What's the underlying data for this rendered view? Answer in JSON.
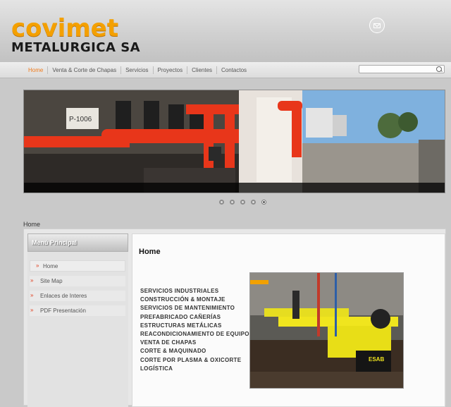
{
  "logo": {
    "line1": "covimet",
    "line2": "METALURGICA SA"
  },
  "header": {
    "mail_icon": "mail-icon"
  },
  "nav": {
    "items": [
      {
        "label": "Home",
        "active": true
      },
      {
        "label": "Venta & Corte de Chapas"
      },
      {
        "label": "Servicios"
      },
      {
        "label": "Proyectos"
      },
      {
        "label": "Clientes"
      },
      {
        "label": "Contactos"
      }
    ]
  },
  "search": {
    "value": "",
    "icon": "search-icon"
  },
  "slider": {
    "dots": 5,
    "active_dot": 5
  },
  "breadcrumb": "Home",
  "sidebar": {
    "title": "Menú Principal",
    "items": [
      {
        "label": "Home",
        "icon": "double-arrow-icon"
      },
      {
        "label": "Site Map",
        "icon": "double-arrow-icon"
      },
      {
        "label": "Enlaces de Interes",
        "icon": "double-arrow-icon"
      },
      {
        "label": "PDF Presentación",
        "icon": "double-arrow-icon"
      }
    ]
  },
  "main": {
    "title": "Home",
    "services": [
      "SERVICIOS INDUSTRIALES",
      "CONSTRUCCIÓN & MONTAJE",
      "SERVICIOS DE MANTENIMIENTO",
      "PREFABRICADO CAÑERÍAS",
      "ESTRUCTURAS METÁLICAS",
      "REACONDICIONAMIENTO DE EQUIPOS",
      "VENTA DE CHAPAS",
      "CORTE & MAQUINADO",
      "CORTE POR PLASMA & OXICORTE",
      "LOGÍSTICA"
    ],
    "machine_brand": "ESAB"
  },
  "colors": {
    "accent": "#f4a000",
    "nav_active": "#f07a1a",
    "pipe": "#e8361a",
    "arrow": "#e03b1a"
  }
}
